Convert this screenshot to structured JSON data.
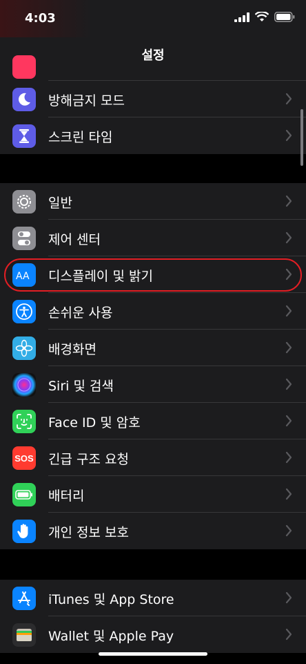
{
  "status": {
    "time": "4:03"
  },
  "nav": {
    "title": "설정"
  },
  "group1": [
    {
      "label": "방해금지 모드",
      "icon": "moon-icon",
      "color": "#5e5ce6"
    },
    {
      "label": "스크린 타임",
      "icon": "hourglass-icon",
      "color": "#5e5ce6"
    }
  ],
  "group2": [
    {
      "label": "일반",
      "icon": "gear-icon",
      "color": "#8e8e93"
    },
    {
      "label": "제어 센터",
      "icon": "toggles-icon",
      "color": "#8e8e93"
    },
    {
      "label": "디스플레이 및 밝기",
      "icon": "text-size-icon",
      "color": "#0a84ff"
    },
    {
      "label": "손쉬운 사용",
      "icon": "accessibility-icon",
      "color": "#0a84ff"
    },
    {
      "label": "배경화면",
      "icon": "flower-icon",
      "color": "#32ade6"
    },
    {
      "label": "Siri 및 검색",
      "icon": "siri-icon",
      "color": "#1c1c1e"
    },
    {
      "label": "Face ID 및 암호",
      "icon": "face-id-icon",
      "color": "#30d158"
    },
    {
      "label": "긴급 구조 요청",
      "icon": "sos-icon",
      "color": "#ff3b30",
      "icon_text": "SOS"
    },
    {
      "label": "배터리",
      "icon": "battery-icon",
      "color": "#30d158"
    },
    {
      "label": "개인 정보 보호",
      "icon": "hand-icon",
      "color": "#0a84ff"
    }
  ],
  "group3": [
    {
      "label": "iTunes 및 App Store",
      "icon": "app-store-icon",
      "color": "#0a84ff"
    },
    {
      "label": "Wallet 및 Apple Pay",
      "icon": "wallet-icon",
      "color": "#3a3a3c"
    }
  ]
}
